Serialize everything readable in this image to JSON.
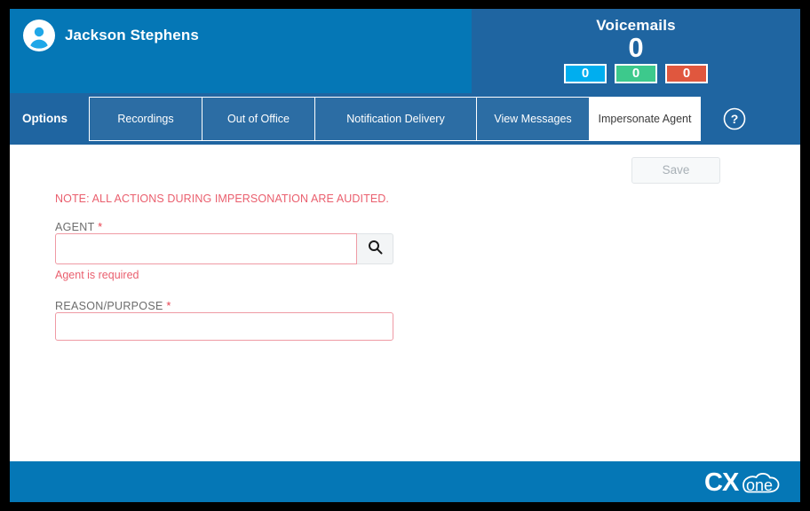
{
  "header": {
    "user_name": "Jackson Stephens",
    "avatar_icon": "user-avatar-icon",
    "left_bg": "#0577b6",
    "right_bg": "#1f65a1"
  },
  "voicemails": {
    "title": "Voicemails",
    "total": "0",
    "badges": [
      {
        "value": "0",
        "color": "#00aeef",
        "name": "new"
      },
      {
        "value": "0",
        "color": "#3dc98c",
        "name": "saved"
      },
      {
        "value": "0",
        "color": "#e0573e",
        "name": "urgent"
      }
    ]
  },
  "tabbar": {
    "options_label": "Options",
    "help_icon": "question-mark-circle-icon",
    "tabs": [
      {
        "label": "Recordings",
        "active": false
      },
      {
        "label": "Out of Office",
        "active": false
      },
      {
        "label": "Notification Delivery",
        "active": false
      },
      {
        "label": "View Messages",
        "active": false
      },
      {
        "label": "Impersonate Agent",
        "active": true
      }
    ]
  },
  "content": {
    "save_label": "Save",
    "save_disabled": true,
    "note": "NOTE: ALL ACTIONS DURING IMPERSONATION ARE AUDITED.",
    "note_color": "#ea5f6e",
    "agent": {
      "label": "AGENT",
      "required_marker": "*",
      "value": "",
      "placeholder": "",
      "error": "Agent is required",
      "search_icon": "search-icon"
    },
    "reason": {
      "label": "REASON/PURPOSE",
      "required_marker": "*",
      "value": "",
      "placeholder": ""
    }
  },
  "footer": {
    "logo_text_primary": "CX",
    "logo_text_secondary": "one",
    "logo_name": "cxone-logo",
    "bg": "#0577b6"
  }
}
